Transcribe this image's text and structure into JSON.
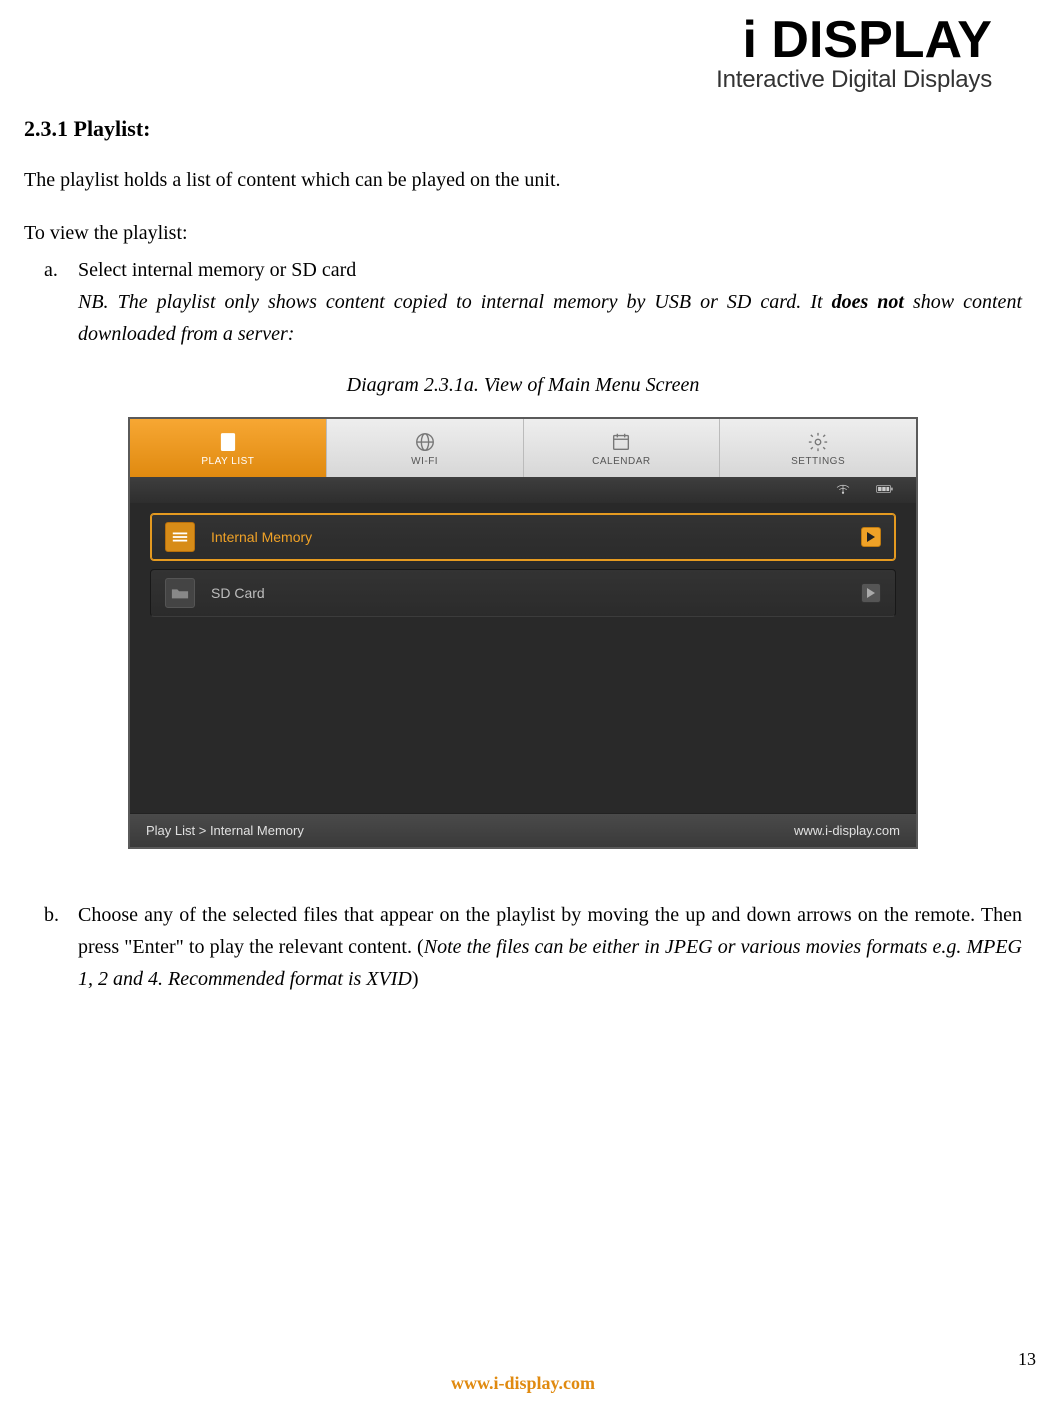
{
  "logo": {
    "line1": "i DISPLAY",
    "line2": "Interactive Digital Displays"
  },
  "section": {
    "number": "2.3.1",
    "title": "Playlist"
  },
  "intro": "The playlist holds a list of content which can be played on the unit.",
  "lead": "To view the playlist:",
  "items": {
    "a": {
      "marker": "a.",
      "text": "Select internal memory or SD card",
      "note_prefix": "NB. The playlist only shows content copied to internal memory by USB or SD card. It ",
      "note_bold": "does not",
      "note_suffix": " show content downloaded from a server:"
    },
    "b": {
      "marker": "b.",
      "text_prefix": "Choose any of the selected files that appear on the playlist by moving the up and down arrows on the remote. Then press \"Enter\" to play the relevant content. (",
      "note": "Note the files can be either in JPEG or various movies formats e.g. MPEG 1, 2 and 4. Recommended format is XVID",
      "text_suffix": ")"
    }
  },
  "diagram_caption": "Diagram 2.3.1a.    View of Main Menu Screen",
  "screenshot": {
    "tabs": {
      "playlist": "PLAY LIST",
      "wifi": "WI-FI",
      "calendar": "CALENDAR",
      "settings": "SETTINGS"
    },
    "rows": {
      "internal": "Internal Memory",
      "sdcard": "SD Card"
    },
    "breadcrumb_left": "Play List > Internal Memory",
    "breadcrumb_right": "www.i-display.com"
  },
  "footer_url": "www.i-display.com",
  "page_number": "13"
}
